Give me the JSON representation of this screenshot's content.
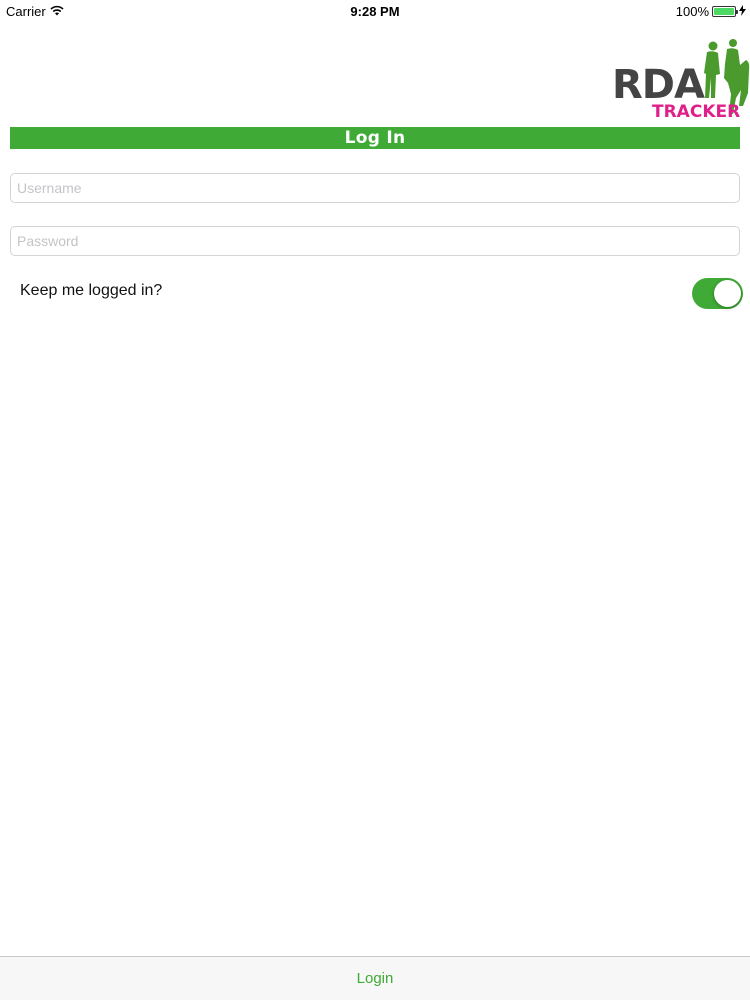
{
  "status_bar": {
    "carrier": "Carrier",
    "time": "9:28 PM",
    "battery": "100%",
    "battery_level": 1.0,
    "wifi_icon": "wifi-icon",
    "charging_icon": "bolt-icon"
  },
  "logo": {
    "text_main": "RDA",
    "text_sub": "TRACKER",
    "colors": {
      "main": "#444444",
      "sub": "#e0208a",
      "figures": "#4a9a2e"
    }
  },
  "header": {
    "title": "Log In"
  },
  "form": {
    "username_placeholder": "Username",
    "password_placeholder": "Password",
    "keep_logged_in_label": "Keep me logged in?",
    "keep_logged_in": true
  },
  "toolbar": {
    "login_label": "Login"
  },
  "colors": {
    "accent": "#3faa35"
  }
}
